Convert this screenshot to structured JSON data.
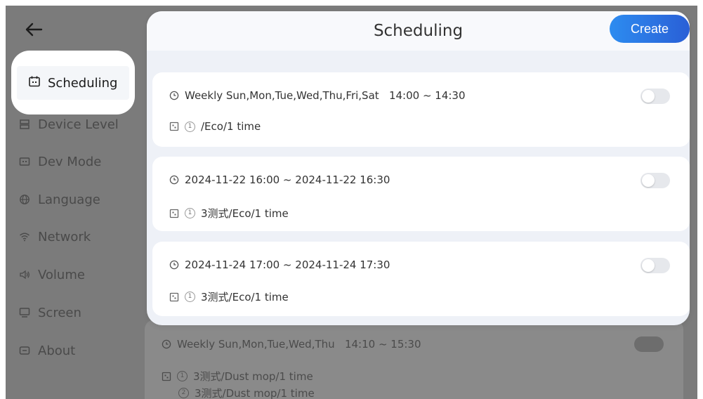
{
  "modal": {
    "title": "Scheduling",
    "create_label": "Create"
  },
  "sidebar": {
    "items": [
      {
        "label": "Scheduling",
        "icon": "calendar-icon",
        "active": true
      },
      {
        "label": "Device Level",
        "icon": "level-icon"
      },
      {
        "label": "Dev Mode",
        "icon": "dev-mode-icon"
      },
      {
        "label": "Language",
        "icon": "globe-icon"
      },
      {
        "label": "Network",
        "icon": "wifi-icon"
      },
      {
        "label": "Volume",
        "icon": "speaker-icon"
      },
      {
        "label": "Screen",
        "icon": "monitor-icon"
      },
      {
        "label": "About",
        "icon": "info-icon"
      }
    ]
  },
  "schedules": [
    {
      "time": "Weekly Sun,Mon,Tue,Wed,Thu,Fri,Sat   14:00 ~ 14:30",
      "task_num": "1",
      "task": "/Eco/1 time",
      "enabled": false
    },
    {
      "time": "2024-11-22 16:00 ~ 2024-11-22 16:30",
      "task_num": "1",
      "task": "3测式/Eco/1 time",
      "enabled": false
    },
    {
      "time": "2024-11-24 17:00 ~ 2024-11-24 17:30",
      "task_num": "1",
      "task": "3测式/Eco/1 time",
      "enabled": false
    }
  ],
  "background_schedule": {
    "time": "Weekly Sun,Mon,Tue,Wed,Thu   14:10 ~ 15:30",
    "tasks": [
      {
        "num": "1",
        "text": "3测式/Dust mop/1 time"
      },
      {
        "num": "2",
        "text": "3测式/Dust mop/1 time"
      }
    ]
  },
  "colors": {
    "accent": "#2d8cf0",
    "overlay": "#7b7b7b",
    "card": "#ffffff",
    "modal_bg": "#eef1f7"
  }
}
